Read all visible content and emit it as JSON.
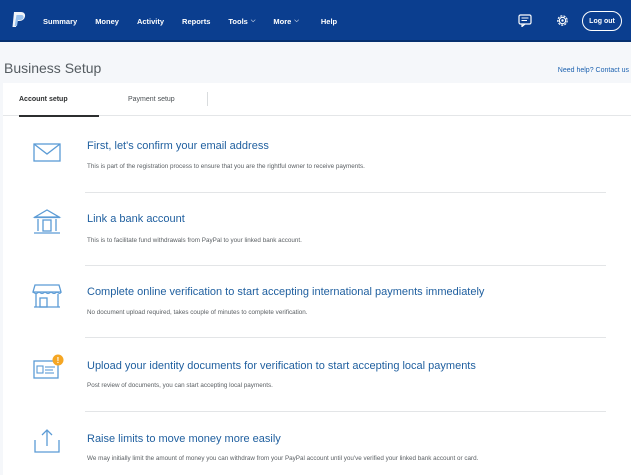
{
  "nav": {
    "items": [
      {
        "label": "Summary"
      },
      {
        "label": "Money"
      },
      {
        "label": "Activity"
      },
      {
        "label": "Reports"
      },
      {
        "label": "Tools"
      },
      {
        "label": "More"
      },
      {
        "label": "Help"
      }
    ],
    "logout_label": "Log out"
  },
  "header": {
    "title": "Business Setup",
    "help_link": "Need help? Contact us"
  },
  "tabs": [
    {
      "label": "Account setup",
      "active": true
    },
    {
      "label": "Payment setup",
      "active": false
    }
  ],
  "steps": [
    {
      "icon": "envelope-icon",
      "title": "First, let's confirm your email address",
      "description": "This is part of the registration process to ensure that you are the rightful owner to receive payments."
    },
    {
      "icon": "bank-icon",
      "title": "Link a bank account",
      "description": "This is to facilitate fund withdrawals from PayPal to your linked bank account."
    },
    {
      "icon": "storefront-icon",
      "title": "Complete online verification to start accepting international payments immediately",
      "description": "No document upload required, takes couple of minutes to complete verification."
    },
    {
      "icon": "id-card-icon",
      "title": "Upload your identity documents for verification to start accepting local payments",
      "description": "Post review of documents, you can start accepting local payments."
    },
    {
      "icon": "upload-icon",
      "title": "Raise limits to move money more easily",
      "description": "We may initially limit the amount of money you can withdraw from your PayPal account until you've verified your linked bank account or card."
    }
  ],
  "colors": {
    "nav_bg": "#0b3e8f",
    "link": "#1f5f9f",
    "alert_badge": "#f5a623"
  }
}
